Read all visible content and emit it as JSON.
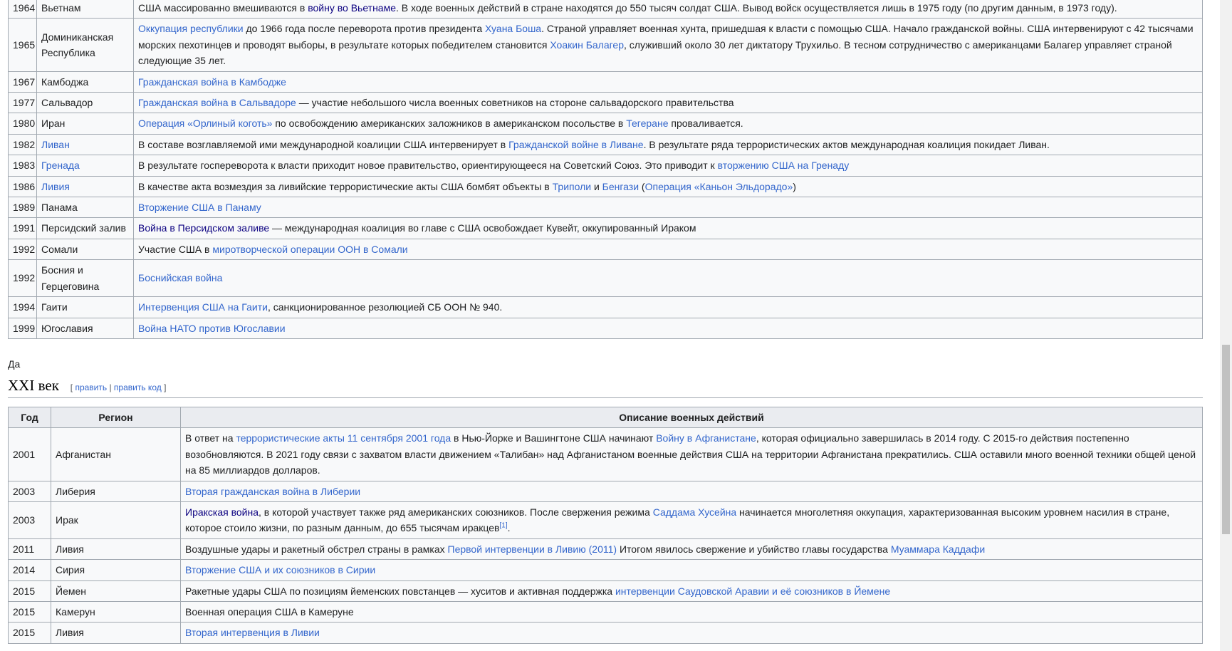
{
  "table20": {
    "rows": [
      {
        "year": "1964",
        "region": "Вьетнам",
        "desc": [
          {
            "t": "США массированно вмешиваются в "
          },
          {
            "l": "войну во Вьетнаме",
            "v": true
          },
          {
            "t": ". В ходе военных действий в стране находятся до 550 тысяч солдат США. Вывод войск осуществляется лишь в 1975 году (по другим данным, в 1973 году)."
          }
        ]
      },
      {
        "year": "1965",
        "region": "Доминиканская Республика",
        "desc": [
          {
            "l": "Оккупация республики"
          },
          {
            "t": " до 1966 года после переворота против президента "
          },
          {
            "l": "Хуана Боша"
          },
          {
            "t": ". Страной управляет военная хунта, пришедшая к власти с помощью США. Начало гражданской войны. США интервенируют с 42 тысячами морских пехотинцев и проводят выборы, в результате которых победителем становится "
          },
          {
            "l": "Хоакин Балагер"
          },
          {
            "t": ", служивший около 30 лет диктатору Трухильо. В тесном сотрудничество с американцами Балагер управляет страной следующие 35 лет."
          }
        ]
      },
      {
        "year": "1967",
        "region": "Камбоджа",
        "desc": [
          {
            "l": "Гражданская война в Камбодже"
          }
        ]
      },
      {
        "year": "1977",
        "region": "Сальвадор",
        "desc": [
          {
            "l": "Гражданская война в Сальвадоре"
          },
          {
            "t": " — участие небольшого числа военных советников на стороне сальвадорского правительства"
          }
        ]
      },
      {
        "year": "1980",
        "region": "Иран",
        "desc": [
          {
            "l": "Операция «Орлиный коготь»"
          },
          {
            "t": " по освобождению американских заложников в американском посольстве в "
          },
          {
            "l": "Тегеране"
          },
          {
            "t": " проваливается."
          }
        ]
      },
      {
        "year": "1982",
        "region": "Ливан",
        "regionLink": true,
        "desc": [
          {
            "t": "В составе возглавляемой ими международной коалиции США интервенирует в "
          },
          {
            "l": "Гражданской войне в Ливане"
          },
          {
            "t": ". В результате ряда террористических актов международная коалиция покидает Ливан."
          }
        ]
      },
      {
        "year": "1983",
        "region": "Гренада",
        "regionLink": true,
        "desc": [
          {
            "t": "В результате госпереворота к власти приходит новое правительство, ориентирующееся на Советский Союз. Это приводит к "
          },
          {
            "l": "вторжению США на Гренаду"
          }
        ]
      },
      {
        "year": "1986",
        "region": "Ливия",
        "regionLink": true,
        "desc": [
          {
            "t": "В качестве акта возмездия за ливийские террористические акты США бомбят объекты в "
          },
          {
            "l": "Триполи"
          },
          {
            "t": " и "
          },
          {
            "l": "Бенгази"
          },
          {
            "t": " ("
          },
          {
            "l": "Операция «Каньон Эльдорадо»"
          },
          {
            "t": ")"
          }
        ]
      },
      {
        "year": "1989",
        "region": "Панама",
        "desc": [
          {
            "l": "Вторжение США в Панаму"
          }
        ]
      },
      {
        "year": "1991",
        "region": "Персидский залив",
        "desc": [
          {
            "l": "Война в Персидском заливе",
            "v": true
          },
          {
            "t": " — международная коалиция во главе с США освобождает Кувейт, оккупированный Ираком"
          }
        ]
      },
      {
        "year": "1992",
        "region": "Сомали",
        "desc": [
          {
            "t": "Участие США в "
          },
          {
            "l": "миротворческой операции ООН в Сомали"
          }
        ]
      },
      {
        "year": "1992",
        "region": "Босния и Герцеговина",
        "desc": [
          {
            "l": "Боснийская война"
          }
        ]
      },
      {
        "year": "1994",
        "region": "Гаити",
        "desc": [
          {
            "l": "Интервенция США на Гаити"
          },
          {
            "t": ", санкционированное резолюцией СБ ООН № 940."
          }
        ]
      },
      {
        "year": "1999",
        "region": "Югославия",
        "desc": [
          {
            "l": "Война НАТО против Югославии"
          }
        ]
      }
    ]
  },
  "paragraph": "Да",
  "section": {
    "title": "XXI век",
    "edit_open": "[ ",
    "edit_label": "править",
    "edit_sep": " | ",
    "edit_code_label": "править код",
    "edit_close": " ]"
  },
  "table21": {
    "headers": [
      "Год",
      "Регион",
      "Описание военных действий"
    ],
    "rows": [
      {
        "year": "2001",
        "region": "Афганистан",
        "desc": [
          {
            "t": "В ответ на "
          },
          {
            "l": "террористические акты 11 сентября 2001 года"
          },
          {
            "t": " в Нью-Йорке и Вашингтоне США начинают "
          },
          {
            "l": "Войну в Афганистане"
          },
          {
            "t": ", которая официально завершилась в 2014 году. С 2015-го действия постепенно возобновляются. В 2021 году связи с захватом власти движением «Талибан» над Афганистаном военные действия США на территории Афганистана прекратились. США оставили много военной техники общей ценой на 85 миллиардов долларов."
          }
        ]
      },
      {
        "year": "2003",
        "region": "Либерия",
        "desc": [
          {
            "l": "Вторая гражданская война в Либерии"
          }
        ]
      },
      {
        "year": "2003",
        "region": "Ирак",
        "desc": [
          {
            "l": "Иракская война",
            "v": true
          },
          {
            "t": ", в которой участвует также ряд американских союзников. После свержения режима "
          },
          {
            "l": "Саддама Хусейна"
          },
          {
            "t": " начинается многолетняя оккупация, характеризованная высоким уровнем насилия в стране, которое стоило жизни, по разным данным, до 655 тысячам иракцев"
          },
          {
            "sup": "[1]"
          },
          {
            "t": "."
          }
        ]
      },
      {
        "year": "2011",
        "region": "Ливия",
        "desc": [
          {
            "t": "Воздушные удары и ракетный обстрел страны в рамках "
          },
          {
            "l": "Первой интервенции в Ливию (2011)"
          },
          {
            "t": " Итогом явилось свержение и убийство главы государства "
          },
          {
            "l": "Муаммара Каддафи"
          }
        ]
      },
      {
        "year": "2014",
        "region": "Сирия",
        "desc": [
          {
            "l": "Вторжение США и их союзников в Сирии"
          }
        ]
      },
      {
        "year": "2015",
        "region": "Йемен",
        "desc": [
          {
            "t": "Ракетные удары США по позициям йеменских повстанцев — хуситов и активная поддержка "
          },
          {
            "l": "интервенции Саудовской Аравии и её союзников в Йемене"
          }
        ]
      },
      {
        "year": "2015",
        "region": "Камерун",
        "desc": [
          {
            "t": "Военная операция США в Камеруне"
          }
        ]
      },
      {
        "year": "2015",
        "region": "Ливия",
        "desc": [
          {
            "l": "Вторая интервенция в Ливии"
          }
        ]
      }
    ]
  }
}
